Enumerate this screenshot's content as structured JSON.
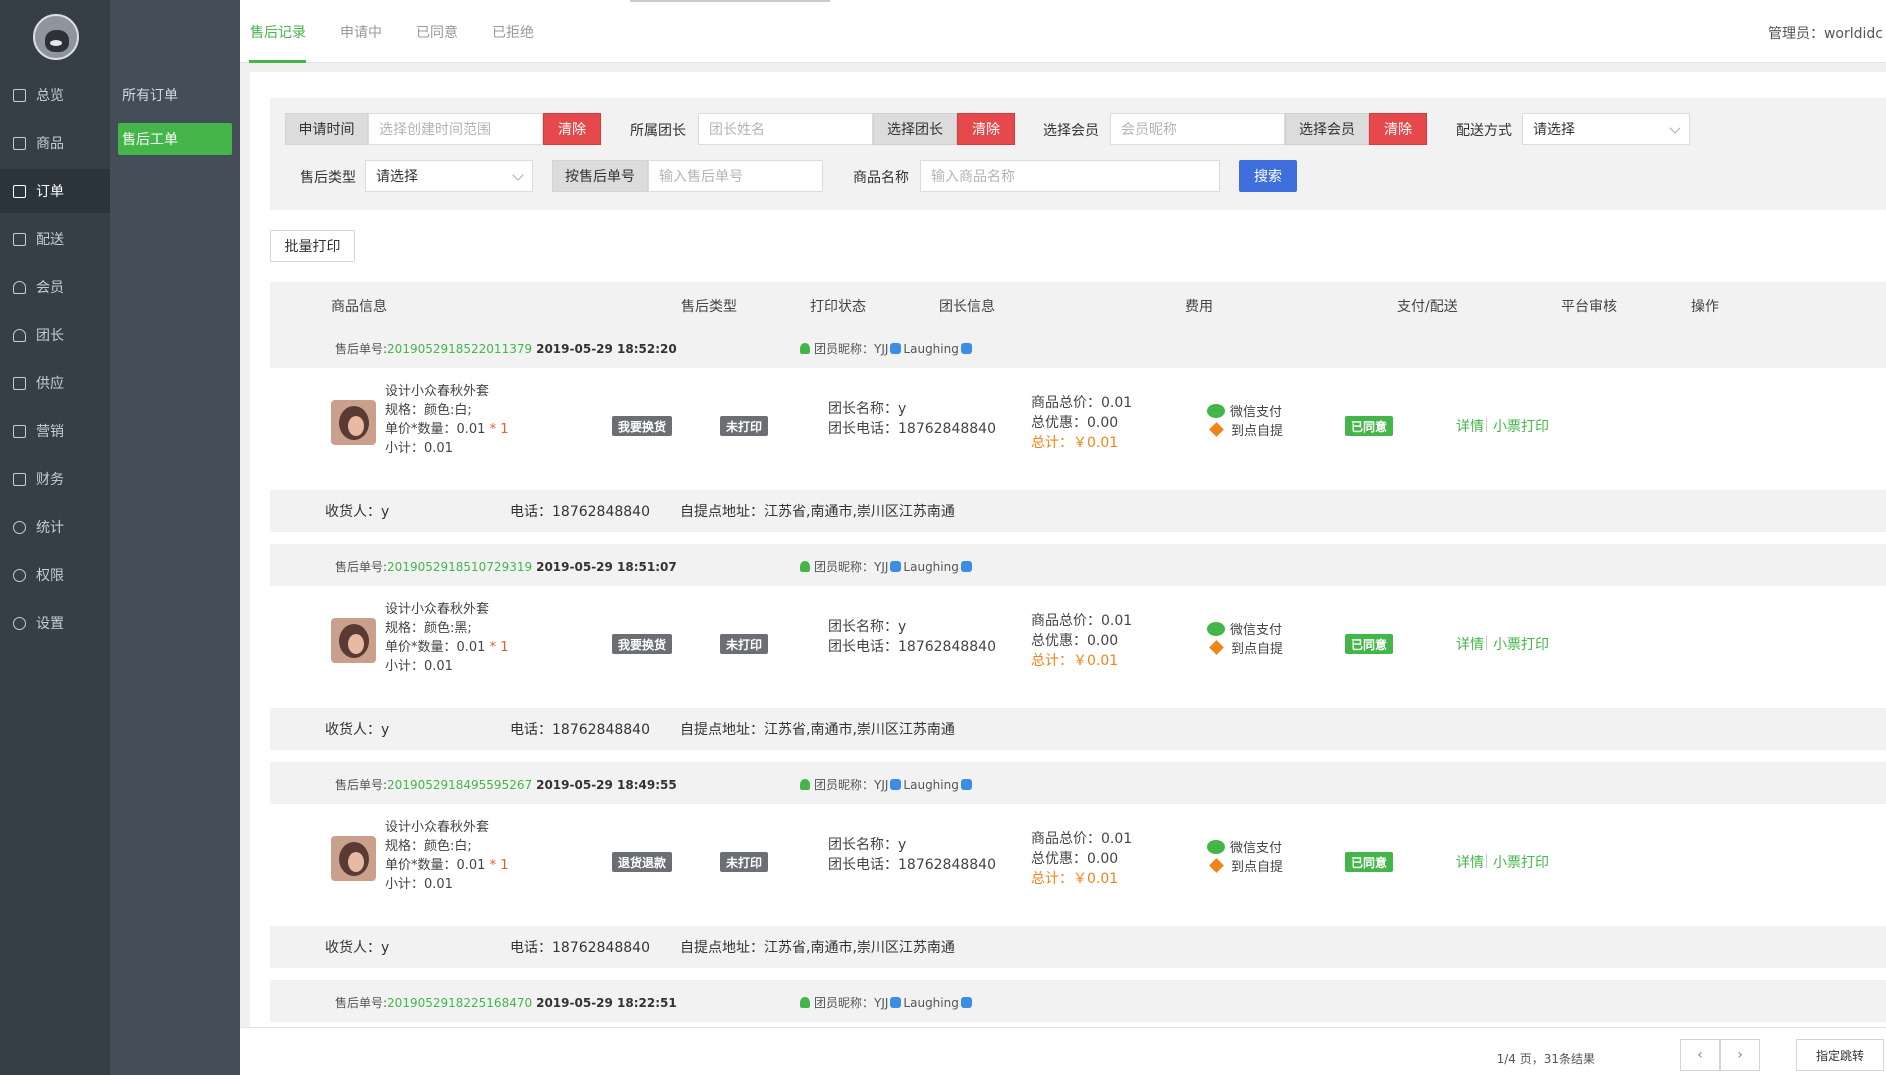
{
  "nav": {
    "items": [
      {
        "label": "总览",
        "icon": "overview-icon"
      },
      {
        "label": "商品",
        "icon": "goods-icon"
      },
      {
        "label": "订单",
        "icon": "order-icon"
      },
      {
        "label": "配送",
        "icon": "delivery-icon"
      },
      {
        "label": "会员",
        "icon": "member-icon"
      },
      {
        "label": "团长",
        "icon": "leader-icon"
      },
      {
        "label": "供应",
        "icon": "supply-icon"
      },
      {
        "label": "营销",
        "icon": "gift-icon"
      },
      {
        "label": "财务",
        "icon": "finance-icon"
      },
      {
        "label": "统计",
        "icon": "stats-icon"
      },
      {
        "label": "权限",
        "icon": "permission-icon"
      },
      {
        "label": "设置",
        "icon": "settings-icon"
      }
    ],
    "sub_items": [
      {
        "label": "所有订单"
      },
      {
        "label": "售后工单"
      }
    ],
    "active_color": "#44b549"
  },
  "top": {
    "tabs": [
      {
        "label": "售后记录"
      },
      {
        "label": "申请中"
      },
      {
        "label": "已同意"
      },
      {
        "label": "已拒绝"
      }
    ],
    "admin": "管理员：worldidc"
  },
  "filters": {
    "apply_time_label": "申请时间",
    "apply_time_placeholder": "选择创建时间范围",
    "clear_label": "清除",
    "leader_label": "所属团长",
    "leader_placeholder": "团长姓名",
    "choose_leader_label": "选择团长",
    "member_label": "选择会员",
    "member_placeholder": "会员昵称",
    "choose_member_label": "选择会员",
    "delivery_label": "配送方式",
    "delivery_value": "请选择",
    "aftersale_type_label": "售后类型",
    "aftersale_type_value": "请选择",
    "by_no_label": "按售后单号",
    "no_placeholder": "输入售后单号",
    "product_label": "商品名称",
    "product_placeholder": "输入商品名称",
    "search_label": "搜索"
  },
  "batch_print": "批量打印",
  "table": {
    "headers": [
      "商品信息",
      "售后类型",
      "打印状态",
      "团长信息",
      "费用",
      "支付/配送",
      "平台审核",
      "操作"
    ]
  },
  "orders": [
    {
      "no_label": "售后单号:",
      "no": "2019052918522011379",
      "time": "2019-05-29 18:52:20",
      "member": "团员昵称：YJJ",
      "member_name": "Laughing",
      "product": "设计小众春秋外套",
      "spec": "规格：颜色:白;",
      "price_qty": "单价*数量：0.01",
      "qty": "* 1",
      "subtotal": "小计：0.01",
      "type": "我要换货",
      "print": "未打印",
      "leader_name": "团长名称：y",
      "leader_phone": "团长电话：18762848840",
      "goods_total": "商品总价：0.01",
      "discount": "总优惠：0.00",
      "total": "总计：￥0.01",
      "pay": "微信支付",
      "delivery": "到点自提",
      "audit": "已同意",
      "detail": "详情",
      "print_ticket": "小票打印",
      "receiver": "收货人：y",
      "phone": "电话：18762848840",
      "address": "自提点地址：江苏省,南通市,崇川区江苏南通"
    },
    {
      "no_label": "售后单号:",
      "no": "2019052918510729319",
      "time": "2019-05-29 18:51:07",
      "member": "团员昵称：YJJ",
      "member_name": "Laughing",
      "product": "设计小众春秋外套",
      "spec": "规格：颜色:黑;",
      "price_qty": "单价*数量：0.01",
      "qty": "* 1",
      "subtotal": "小计：0.01",
      "type": "我要换货",
      "print": "未打印",
      "leader_name": "团长名称：y",
      "leader_phone": "团长电话：18762848840",
      "goods_total": "商品总价：0.01",
      "discount": "总优惠：0.00",
      "total": "总计：￥0.01",
      "pay": "微信支付",
      "delivery": "到点自提",
      "audit": "已同意",
      "detail": "详情",
      "print_ticket": "小票打印",
      "receiver": "收货人：y",
      "phone": "电话：18762848840",
      "address": "自提点地址：江苏省,南通市,崇川区江苏南通"
    },
    {
      "no_label": "售后单号:",
      "no": "2019052918495595267",
      "time": "2019-05-29 18:49:55",
      "member": "团员昵称：YJJ",
      "member_name": "Laughing",
      "product": "设计小众春秋外套",
      "spec": "规格：颜色:白;",
      "price_qty": "单价*数量：0.01",
      "qty": "* 1",
      "subtotal": "小计：0.01",
      "type": "退货退款",
      "print": "未打印",
      "leader_name": "团长名称：y",
      "leader_phone": "团长电话：18762848840",
      "goods_total": "商品总价：0.01",
      "discount": "总优惠：0.00",
      "total": "总计：￥0.01",
      "pay": "微信支付",
      "delivery": "到点自提",
      "audit": "已同意",
      "detail": "详情",
      "print_ticket": "小票打印",
      "receiver": "收货人：y",
      "phone": "电话：18762848840",
      "address": "自提点地址：江苏省,南通市,崇川区江苏南通"
    },
    {
      "no_label": "售后单号:",
      "no": "2019052918225168470",
      "time": "2019-05-29 18:22:51",
      "member": "团员昵称：YJJ",
      "member_name": "Laughing"
    }
  ],
  "pager": {
    "info": "1/4 页，31条结果",
    "prev": "‹",
    "next": "›",
    "jump": "指定跳转"
  }
}
